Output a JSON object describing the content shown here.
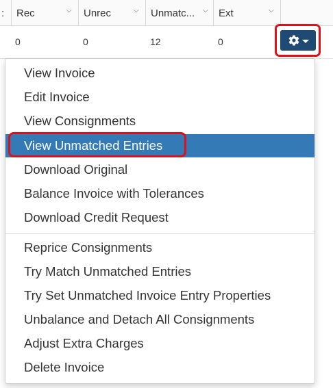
{
  "grid": {
    "columns": [
      {
        "label": ":"
      },
      {
        "label": "Rec"
      },
      {
        "label": "Unrec"
      },
      {
        "label": "Unmatc..."
      },
      {
        "label": "Ext"
      }
    ],
    "row": {
      "rec": "0",
      "unrec": "0",
      "unmatched": "12",
      "ext": "0"
    }
  },
  "actions_button": {
    "icon": "gear-icon",
    "color": "#1f4a74",
    "highlight_color": "#e0101a"
  },
  "menu": {
    "group1": [
      {
        "label": "View Invoice"
      },
      {
        "label": "Edit Invoice"
      },
      {
        "label": "View Consignments"
      },
      {
        "label": "View Unmatched Entries",
        "active": true
      },
      {
        "label": "Download Original"
      },
      {
        "label": "Balance Invoice with Tolerances"
      },
      {
        "label": "Download Credit Request"
      }
    ],
    "group2": [
      {
        "label": "Reprice Consignments"
      },
      {
        "label": "Try Match Unmatched Entries"
      },
      {
        "label": "Try Set Unmatched Invoice Entry Properties"
      },
      {
        "label": "Unbalance and Detach All Consignments"
      },
      {
        "label": "Adjust Extra Charges"
      },
      {
        "label": "Delete Invoice"
      }
    ],
    "active_color": "#337ab7"
  }
}
